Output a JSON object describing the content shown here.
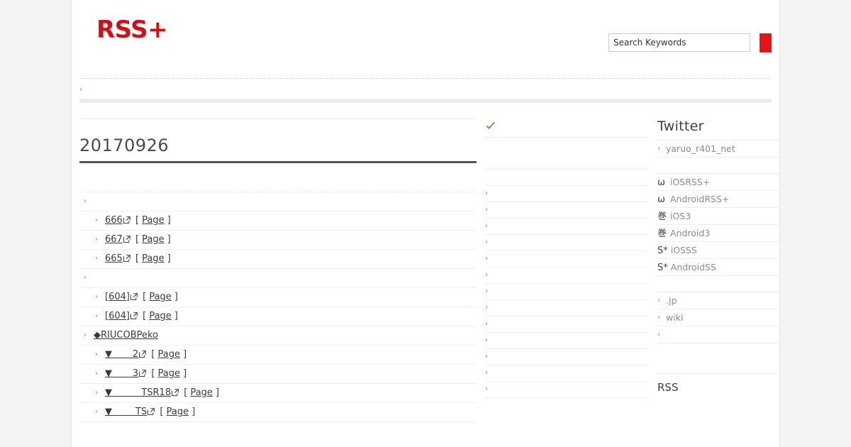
{
  "site": {
    "logo": "RSS+",
    "search": {
      "placeholder": "Search Keywords",
      "value": "",
      "button_label": "",
      "button_color": "#e8131a"
    }
  },
  "nav": {
    "items": [
      {
        "label": "",
        "icon": "chevron-right-icon"
      }
    ]
  },
  "main": {
    "top_rule": "",
    "post_title": "20170926",
    "entries": [
      {
        "level": 0,
        "marker": "chevron-right-icon",
        "link": "",
        "has_ext": false,
        "page_label": "",
        "pad": 0
      },
      {
        "level": 1,
        "marker": "chevron-right-icon",
        "link": "666",
        "has_ext": true,
        "page_label": "Page",
        "pad": 0
      },
      {
        "level": 1,
        "marker": "chevron-right-icon",
        "link": "667",
        "has_ext": true,
        "page_label": "Page",
        "pad": 0
      },
      {
        "level": 1,
        "marker": "chevron-right-icon",
        "link": "665",
        "has_ext": true,
        "page_label": "Page",
        "pad": 0
      },
      {
        "level": 0,
        "marker": "chevron-right-icon",
        "link": "",
        "has_ext": false,
        "page_label": "",
        "pad": 0
      },
      {
        "level": 1,
        "marker": "chevron-right-icon",
        "link": "[604]",
        "has_ext": true,
        "page_label": "Page",
        "pad": 38
      },
      {
        "level": 1,
        "marker": "chevron-right-icon",
        "link": "[604]",
        "has_ext": true,
        "page_label": "Page",
        "pad": 38
      },
      {
        "level": 0,
        "marker": "chevron-right-icon",
        "link": "◆RIUCOBPeko",
        "has_ext": false,
        "page_label": "",
        "pad": 10
      },
      {
        "level": 1,
        "marker": "chevron-right-icon",
        "link": "▼       2",
        "has_ext": true,
        "page_label": "Page",
        "pad": 90
      },
      {
        "level": 1,
        "marker": "chevron-right-icon",
        "link": "▼       3",
        "has_ext": true,
        "page_label": "Page",
        "pad": 90
      },
      {
        "level": 1,
        "marker": "chevron-right-icon",
        "link": "▼          TSR18",
        "has_ext": true,
        "page_label": "Page",
        "pad": 110
      },
      {
        "level": 1,
        "marker": "chevron-right-icon",
        "link": "▼        TS",
        "has_ext": true,
        "page_label": "Page",
        "pad": 100
      }
    ]
  },
  "mid": {
    "status_icon": "green-check-icon",
    "rows": [
      {
        "marker": "",
        "label": ""
      },
      {
        "marker": "chevron-right-icon",
        "label": ""
      },
      {
        "marker": "chevron-right-icon",
        "label": ""
      },
      {
        "marker": "chevron-right-icon",
        "label": ""
      },
      {
        "marker": "chevron-right-icon",
        "label": ""
      },
      {
        "marker": "chevron-right-icon",
        "label": ""
      },
      {
        "marker": "chevron-right-icon",
        "label": ""
      },
      {
        "marker": "chevron-right-icon",
        "label": ""
      },
      {
        "marker": "chevron-right-icon",
        "label": ""
      },
      {
        "marker": "chevron-right-icon",
        "label": ""
      },
      {
        "marker": "chevron-right-icon",
        "label": ""
      },
      {
        "marker": "chevron-right-icon",
        "label": ""
      },
      {
        "marker": "chevron-right-icon",
        "label": ""
      },
      {
        "marker": "chevron-right-icon",
        "label": ""
      }
    ]
  },
  "sidebar": {
    "title": "Twitter",
    "account": {
      "marker": "chevron-right-icon",
      "label": "yaruo_r401_net"
    },
    "apps": [
      {
        "glyph": "ω",
        "label": "iOSRSS+"
      },
      {
        "glyph": "ω",
        "label": "AndroidRSS+"
      },
      {
        "glyph": "巻",
        "label": "iOS3"
      },
      {
        "glyph": "巻",
        "label": "Android3"
      },
      {
        "glyph": "S*",
        "label": "iOSSS"
      },
      {
        "glyph": "S*",
        "label": "AndroidSS"
      }
    ],
    "links": [
      {
        "marker": "chevron-right-icon",
        "label": ".jp"
      },
      {
        "marker": "chevron-right-icon",
        "label": "wiki"
      },
      {
        "marker": "chevron-right-icon",
        "label": ""
      }
    ],
    "rss_heading": "RSS"
  }
}
